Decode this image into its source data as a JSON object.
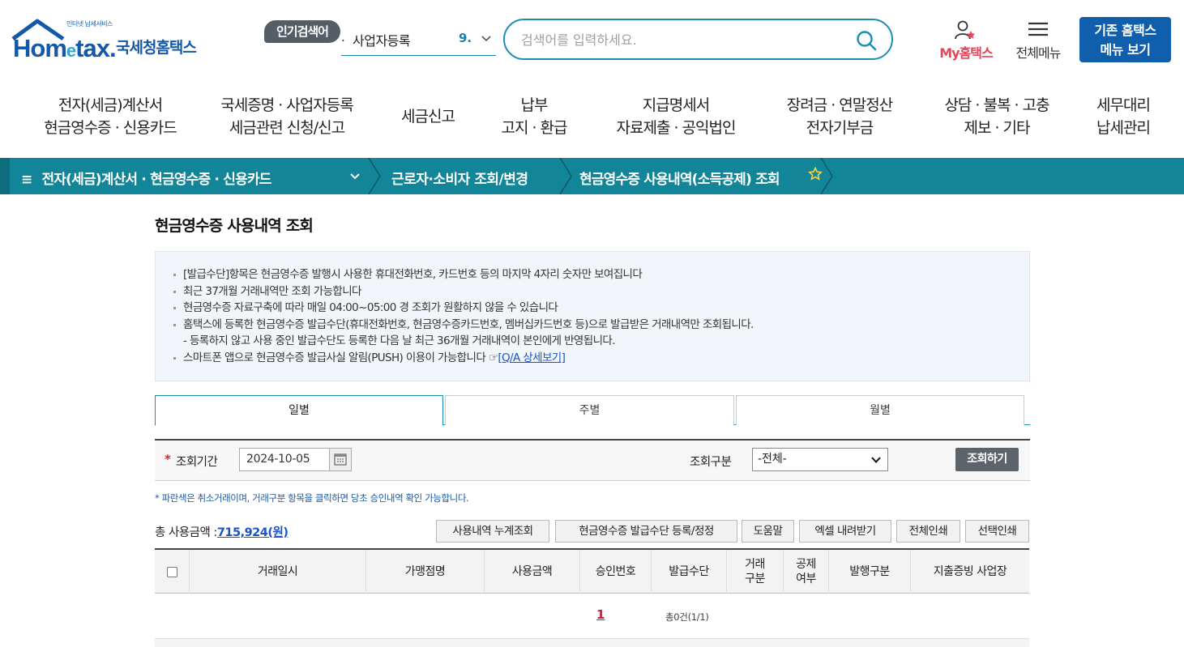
{
  "header": {
    "logo_small": "인터넷 납세서비스",
    "logo_word_a": "Hom",
    "logo_word_e": "e",
    "logo_word_b": "tax.",
    "logo_kor": "국세청홈택스",
    "popular_badge": "인기검색어",
    "popular_dot": ".",
    "popular_keyword": "사업자등록",
    "popular_rank": "9.",
    "search_placeholder": "검색어를 입력하세요.",
    "my_label": "My홈택스",
    "allmenu_label": "전체메뉴",
    "oldsite_line1": "기존 홈택스",
    "oldsite_line2": "메뉴 보기"
  },
  "gnb": [
    {
      "line1": "전자(세금)계산서",
      "line2": "현금영수증 · 신용카드"
    },
    {
      "line1": "국세증명 · 사업자등록",
      "line2": "세금관련 신청/신고"
    },
    {
      "line1": "세금신고",
      "line2": ""
    },
    {
      "line1": "납부",
      "line2": "고지 · 환급"
    },
    {
      "line1": "지급명세서",
      "line2": "자료제출 · 공익법인"
    },
    {
      "line1": "장려금 · 연말정산",
      "line2": "전자기부금"
    },
    {
      "line1": "상담 · 불복 · 고충",
      "line2": "제보 · 기타"
    },
    {
      "line1": "세무대리",
      "line2": "납세관리"
    }
  ],
  "breadcrumb": {
    "level1": "전자(세금)계산서 · 현금영수증 · 신용카드",
    "level2": "근로자·소비자 조회/변경",
    "level3": "현금영수증 사용내역(소득공제) 조회"
  },
  "page_title": "현금영수증 사용내역 조회",
  "notice": {
    "items": [
      "[발급수단]항목은 현금영수증 발행시 사용한 휴대전화번호, 카드번호 등의 마지막 4자리 숫자만 보여집니다",
      "최근 37개월 거래내역만 조회 가능합니다",
      "현금영수증 자료구축에 따라 매일 04:00~05:00 경 조회가 원활하지 않을 수 있습니다",
      "홈택스에 등록한 현금영수증 발급수단(휴대전화번호, 현금영수증카드번호, 멤버십카드번호 등)으로 발급받은 거래내역만 조회됩니다."
    ],
    "sub_item": "- 등록하지 않고 사용 중인 발급수단도 등록한 다음 날 최근 36개월 거래내역이 본인에게 반영됩니다.",
    "push_item": "스마트폰 앱으로 현금영수증 발급사실 알림(PUSH) 이용이 가능합니다 ☞",
    "push_link": "[Q/A 상세보기]"
  },
  "tabs": [
    {
      "label": "일별",
      "active": true
    },
    {
      "label": "주별",
      "active": false
    },
    {
      "label": "월별",
      "active": false
    }
  ],
  "search": {
    "required_mark": "*",
    "period_label": "조회기간",
    "date_value": "2024-10-05",
    "type_label": "조회구분",
    "type_value": "-전체-",
    "query_button": "조회하기"
  },
  "hint": "* 파란색은 취소거래이며, 거래구분 항목을 클릭하면 당초 승인내역 확인 가능합니다.",
  "total": {
    "label": "총 사용금액 :",
    "amount": "715,924(원)"
  },
  "buttons": {
    "cumulative": "사용내역 누계조회",
    "register": "현금영수증 발급수단 등록/정정",
    "help": "도움말",
    "excel": "엑셀 내려받기",
    "print_all": "전체인쇄",
    "print_selected": "선택인쇄"
  },
  "table": {
    "columns": [
      "거래일시",
      "가맹점명",
      "사용금액",
      "승인번호",
      "발급수단",
      "거래\n구분",
      "공제\n여부",
      "발행구분",
      "지출증빙 사업장"
    ]
  },
  "pagination": {
    "current_page": "1",
    "count_text": "총0건(1/1)"
  },
  "colors": {
    "teal_bar": "#128598",
    "brand_blue": "#0f5fac",
    "my_red": "#e5455b"
  }
}
